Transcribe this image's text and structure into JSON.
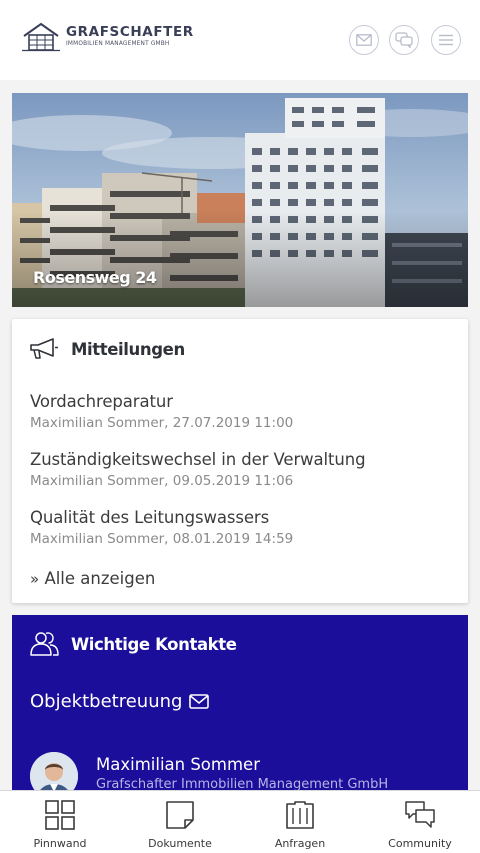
{
  "header": {
    "brand_title": "GRAFSCHAFTER",
    "brand_subtitle": "IMMOBILIEN MANAGEMENT GMBH",
    "buttons": [
      "mail-icon",
      "chat-icon",
      "menu-icon"
    ]
  },
  "hero": {
    "caption": "Rosensweg 24"
  },
  "messages": {
    "title": "Mitteilungen",
    "items": [
      {
        "title": "Vordachreparatur",
        "meta": "Maximilian Sommer, 27.07.2019 11:00"
      },
      {
        "title": "Zuständigkeitswechsel in der Verwaltung",
        "meta": "Maximilian Sommer, 09.05.2019 11:06"
      },
      {
        "title": "Qualität des Leitungswassers",
        "meta": "Maximilian Sommer, 08.01.2019 14:59"
      }
    ],
    "show_all": "Alle anzeigen"
  },
  "contacts": {
    "title": "Wichtige Kontakte",
    "section_label": "Objektbetreuung",
    "person": {
      "name": "Maximilian Sommer",
      "company": "Grafschafter Immobilien Management GmbH"
    }
  },
  "nav": {
    "items": [
      {
        "label": "Pinnwand",
        "icon": "grid-icon"
      },
      {
        "label": "Dokumente",
        "icon": "document-icon"
      },
      {
        "label": "Anfragen",
        "icon": "folder-icon"
      },
      {
        "label": "Community",
        "icon": "community-icon"
      }
    ]
  },
  "colors": {
    "accent": "#1a0e9a",
    "brand": "#3a3f58"
  }
}
